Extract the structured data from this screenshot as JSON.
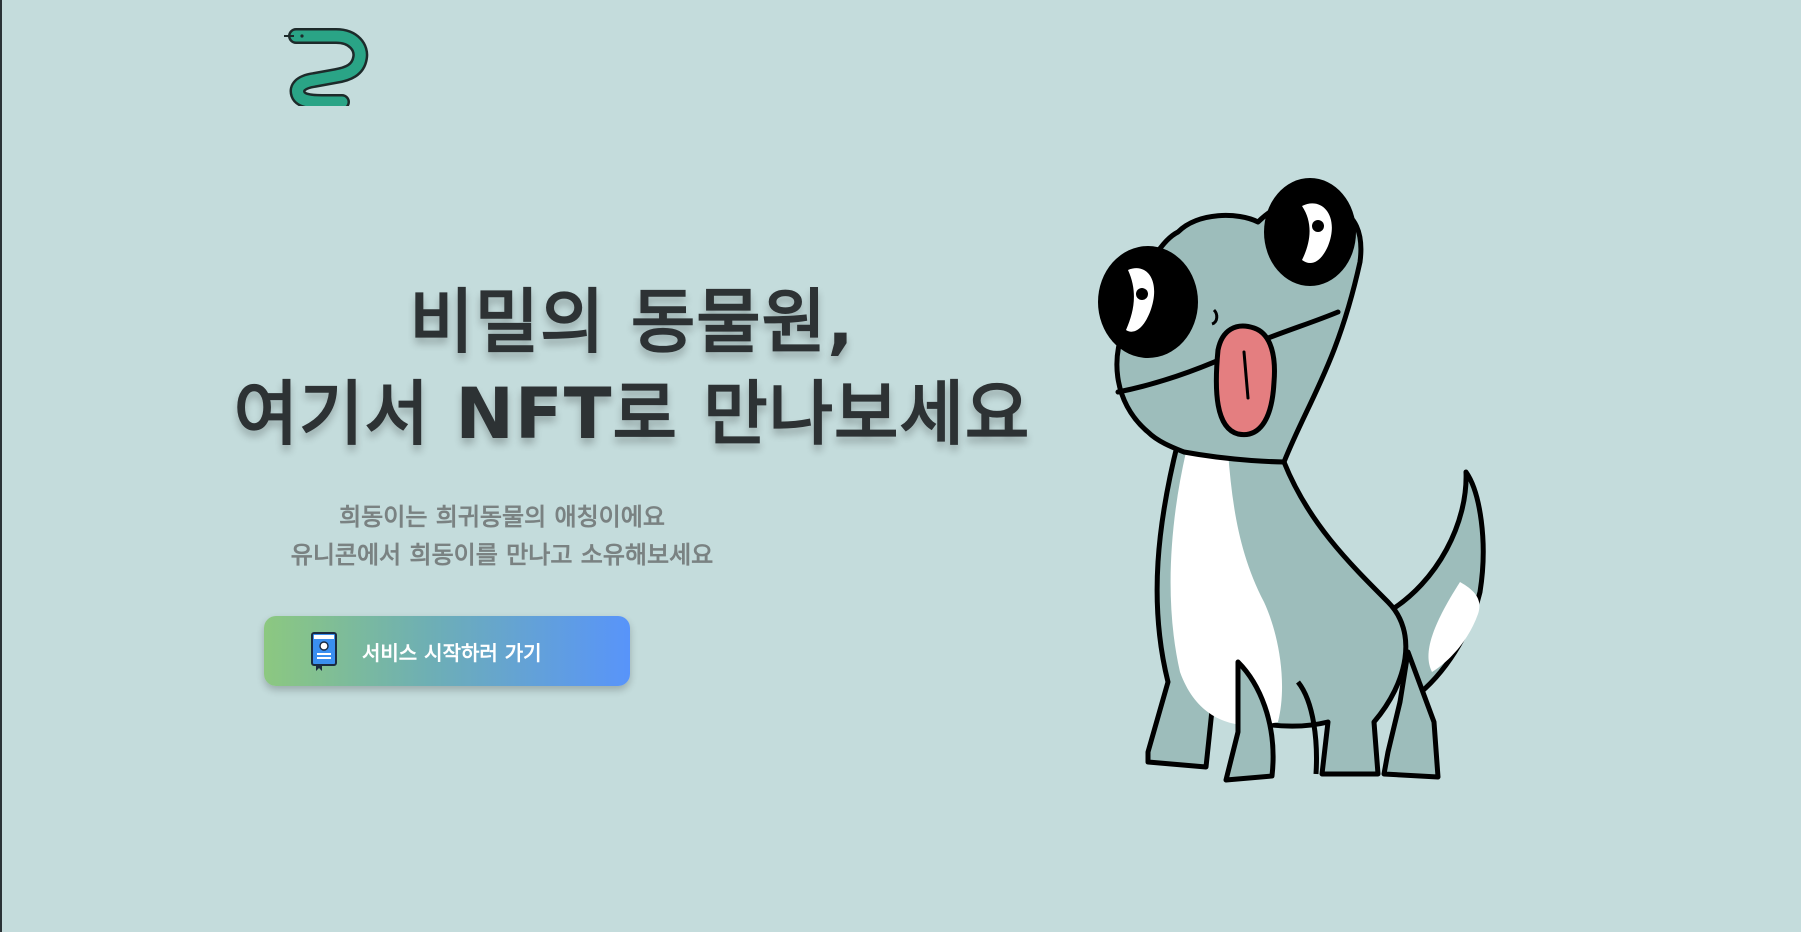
{
  "logo": {
    "icon": "snake-logo-icon",
    "color": "#2aa486"
  },
  "hero": {
    "title_line1": "비밀의 동물원,",
    "title_line2": "여기서 NFT로 만나보세요",
    "subtitle_line1": "희동이는 희귀동물의 애칭이에요",
    "subtitle_line2": "유니콘에서 희동이를 만나고 소유해보세요"
  },
  "cta": {
    "label": "서비스 시작하러 가기",
    "icon": "passport-book-icon",
    "gradient_start": "#8cc880",
    "gradient_end": "#5894fa"
  },
  "mascot": {
    "icon": "lizard-mascot-illustration",
    "body_color": "#9dbdbb",
    "belly_color": "#ffffff",
    "tongue_color": "#e47e80"
  },
  "theme": {
    "background": "#c4dcdc",
    "title_color": "#2d3234",
    "subtitle_color": "#7a8282"
  }
}
